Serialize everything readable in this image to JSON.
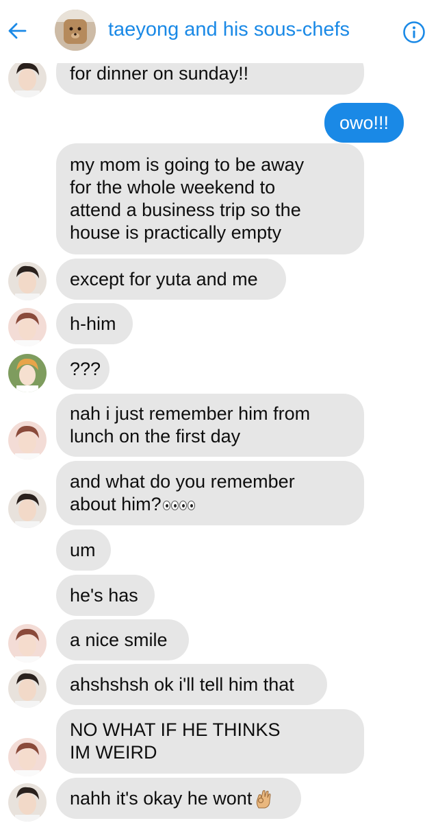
{
  "header": {
    "title": "taeyong and his sous-chefs"
  },
  "colors": {
    "accent": "#1a89e6",
    "bubble_in": "#e6e6e6",
    "text": "#0e0e0e"
  },
  "messages": [
    {
      "sender": "friend-a",
      "lines": [
        "for dinner on sunday!!"
      ]
    },
    {
      "sender": "me",
      "lines": [
        "owo!!!"
      ]
    },
    {
      "sender": "friend-a",
      "lines": [
        "my mom is going to be away",
        "for the whole weekend to",
        "attend a business trip so the",
        "house is practically empty"
      ]
    },
    {
      "sender": "friend-a",
      "lines": [
        "except for yuta and me"
      ]
    },
    {
      "sender": "friend-b",
      "lines": [
        "h-him"
      ]
    },
    {
      "sender": "friend-c",
      "lines": [
        "???"
      ]
    },
    {
      "sender": "friend-b",
      "lines": [
        "nah i just remember him from",
        "lunch on the first day"
      ]
    },
    {
      "sender": "friend-a",
      "lines": [
        "and what do you remember",
        "about him?"
      ],
      "emoji": "eyes-emoji"
    },
    {
      "sender": "friend-b",
      "lines": [
        "um"
      ]
    },
    {
      "sender": "friend-b",
      "lines": [
        "he's has"
      ]
    },
    {
      "sender": "friend-b",
      "lines": [
        "a nice smile"
      ]
    },
    {
      "sender": "friend-a",
      "lines": [
        "ahshshsh ok i'll tell him that"
      ]
    },
    {
      "sender": "friend-b",
      "lines": [
        "NO WHAT IF HE THINKS",
        "IM WEIRD"
      ]
    },
    {
      "sender": "friend-a",
      "lines": [
        "nahh it's okay he wont"
      ],
      "emoji": "ok-hand-emoji"
    }
  ]
}
